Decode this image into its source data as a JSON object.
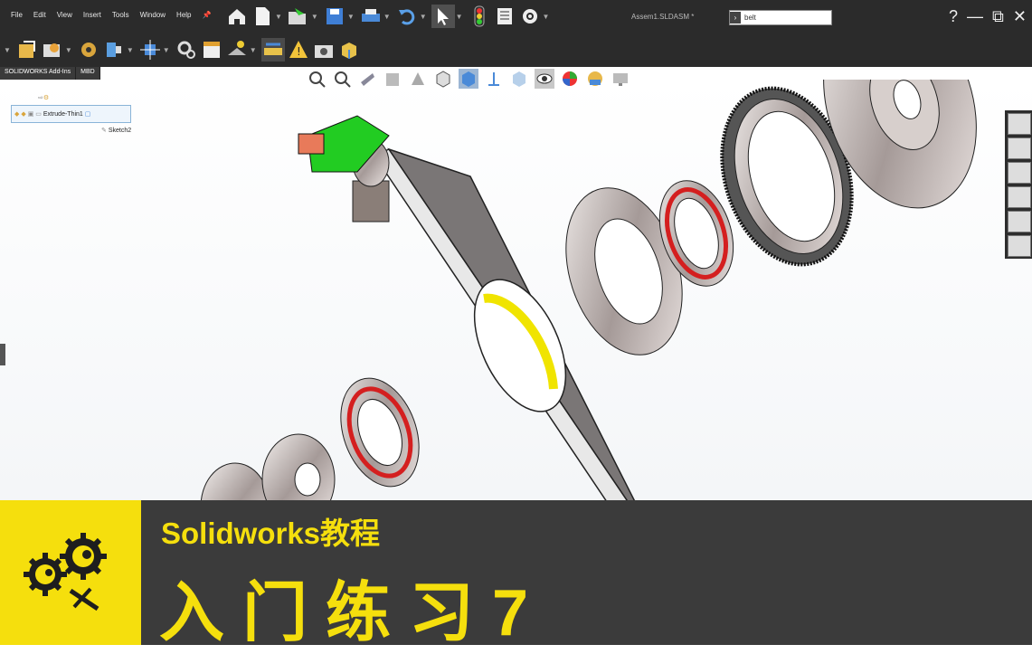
{
  "menu": [
    "File",
    "Edit",
    "View",
    "Insert",
    "Tools",
    "Window",
    "Help"
  ],
  "document_title": "Assem1.SLDASM *",
  "search": {
    "value": "belt"
  },
  "window_controls": {
    "help": "?",
    "minimize": "—",
    "restore": "⧉",
    "close": "✕"
  },
  "tabs": [
    "SOLIDWORKS Add-Ins",
    "MBD"
  ],
  "tree": {
    "items": [
      "Extrude-Thin1",
      "Sketch2"
    ]
  },
  "banner": {
    "title": "Solidworks教程",
    "subtitle": "入门练习7"
  },
  "colors": {
    "accent": "#f5df0d",
    "banner_bg": "#3b3b3b",
    "chrome": "#2b2b2b",
    "green": "#22cc22",
    "red": "#d41f1f",
    "yellow": "#f0e400"
  }
}
